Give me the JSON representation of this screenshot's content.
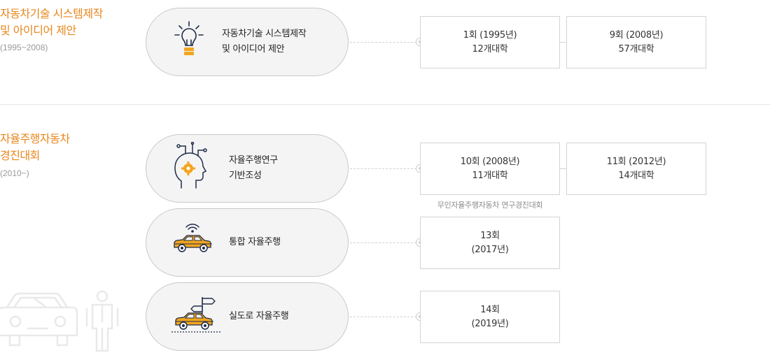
{
  "sections": [
    {
      "title_line1": "자동차기술 시스템제작",
      "title_line2": "및 아이디어 제안",
      "period": "(1995~2008)",
      "items": [
        {
          "label": "자동차기술 시스템제작\n및 아이디어 제안",
          "icon": "lightbulb-icon",
          "records": [
            {
              "round": "1회 (1995년)",
              "count": "12개대학"
            },
            {
              "round": "9회 (2008년)",
              "count": "57개대학"
            }
          ]
        }
      ]
    },
    {
      "title_line1": "자율주행자동차",
      "title_line2": "경진대회",
      "period": "(2010~)",
      "items": [
        {
          "label": "자율주행연구\n기반조성",
          "icon": "ai-head-icon",
          "records": [
            {
              "round": "10회 (2008년)",
              "count": "11개대학"
            },
            {
              "round": "11회 (2012년)",
              "count": "14개대학"
            }
          ],
          "note": "무인자율주행자동차 연구경진대회"
        },
        {
          "label": "통합 자율주행",
          "icon": "connected-car-icon",
          "records": [
            {
              "round": "13회",
              "count": "(2017년)"
            }
          ]
        },
        {
          "label": "실도로 자율주행",
          "icon": "road-car-icon",
          "records": [
            {
              "round": "14회",
              "count": "(2019년)"
            }
          ]
        }
      ]
    }
  ],
  "colors": {
    "accent": "#e8871e",
    "car": "#f2a51f",
    "icon_dark": "#1f2d4a"
  },
  "decoration": "car-and-person-illustration"
}
